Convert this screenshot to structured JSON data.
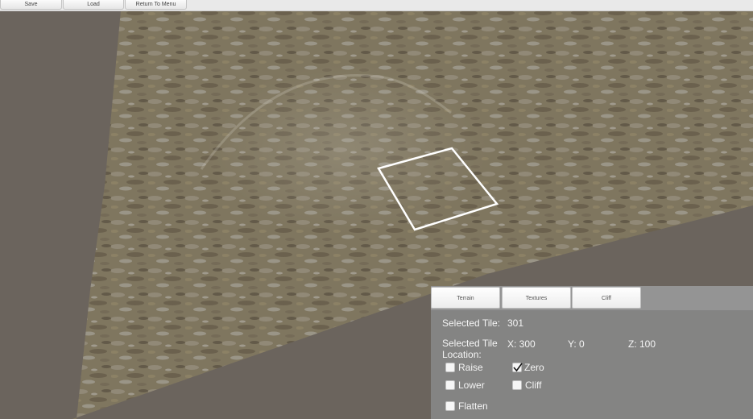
{
  "menu": {
    "save_label": "Save",
    "load_label": "Load",
    "return_label": "Return To Menu"
  },
  "panel": {
    "tabs": [
      {
        "label": "Terrain"
      },
      {
        "label": "Textures"
      },
      {
        "label": "Cliff"
      }
    ],
    "selected_tile_label": "Selected Tile:",
    "selected_tile_value": "301",
    "location_label_line1": "Selected Tile",
    "location_label_line2": "Location:",
    "x_text": "X: 300",
    "y_text": "Y: 0",
    "z_text": "Z: 100",
    "options": {
      "raise": {
        "label": "Raise",
        "checked": false
      },
      "zero": {
        "label": "Zero",
        "checked": true
      },
      "lower": {
        "label": "Lower",
        "checked": false
      },
      "cliff": {
        "label": "Cliff",
        "checked": false
      },
      "flatten": {
        "label": "Flatten",
        "checked": false
      }
    }
  },
  "colors": {
    "background": "#6b645d",
    "terrain_base": "#8a8068",
    "panel": "#868686",
    "selection_outline": "#ffffff"
  }
}
